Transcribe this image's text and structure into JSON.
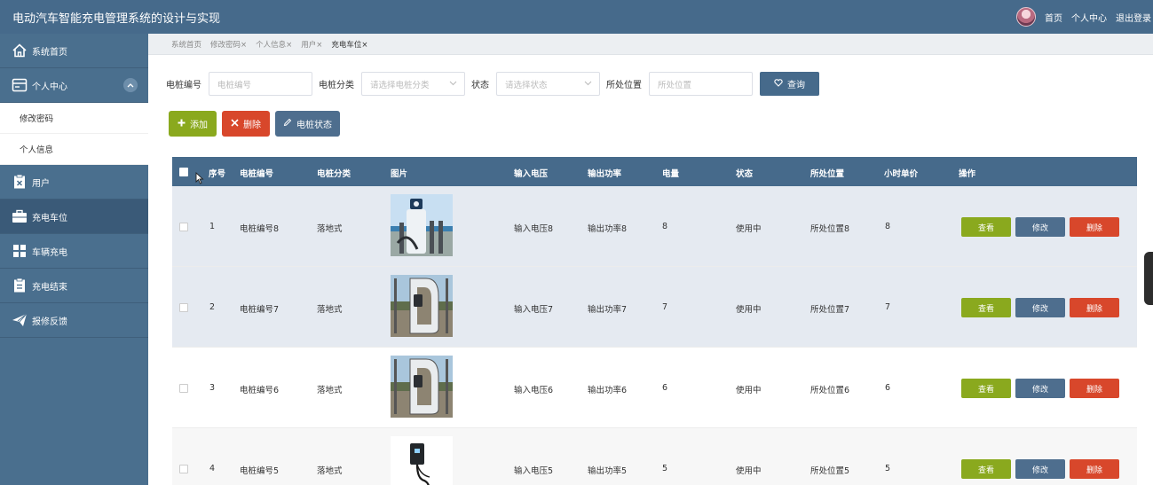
{
  "app": {
    "title": "电动汽车智能充电管理系统的设计与实现"
  },
  "topnav": {
    "home": "首页",
    "profile": "个人中心",
    "logout": "退出登录"
  },
  "sidebar": {
    "items": [
      {
        "label": "系统首页",
        "icon": "home-icon"
      },
      {
        "label": "个人中心",
        "icon": "user-card-icon"
      },
      {
        "label": "修改密码"
      },
      {
        "label": "个人信息"
      },
      {
        "label": "用户",
        "icon": "clipboard-x-icon"
      },
      {
        "label": "充电车位",
        "icon": "briefcase-icon"
      },
      {
        "label": "车辆充电",
        "icon": "grid-icon"
      },
      {
        "label": "充电结束",
        "icon": "clipboard-icon"
      },
      {
        "label": "报修反馈",
        "icon": "paper-plane-icon"
      }
    ]
  },
  "tabs": [
    "系统首页",
    "修改密码×",
    "个人信息×",
    "用户×",
    "充电车位×"
  ],
  "search": {
    "pile_no_label": "电桩编号",
    "pile_no_placeholder": "电桩编号",
    "category_label": "电桩分类",
    "category_placeholder": "请选择电桩分类",
    "status_label": "状态",
    "status_placeholder": "请选择状态",
    "location_label": "所处位置",
    "location_placeholder": "所处位置",
    "button": "查询"
  },
  "actions": {
    "add": "添加",
    "delete": "删除",
    "pile_status": "电桩状态"
  },
  "table": {
    "headers": [
      "序号",
      "电桩编号",
      "电桩分类",
      "图片",
      "输入电压",
      "输出功率",
      "电量",
      "状态",
      "所处位置",
      "小时单价",
      "操作"
    ],
    "rows": [
      {
        "idx": "1",
        "pile_no": "电桩编号8",
        "category": "落地式",
        "voltage": "输入电压8",
        "power": "输出功率8",
        "charge": "8",
        "status": "使用中",
        "location": "所处位置8",
        "price": "8"
      },
      {
        "idx": "2",
        "pile_no": "电桩编号7",
        "category": "落地式",
        "voltage": "输入电压7",
        "power": "输出功率7",
        "charge": "7",
        "status": "使用中",
        "location": "所处位置7",
        "price": "7"
      },
      {
        "idx": "3",
        "pile_no": "电桩编号6",
        "category": "落地式",
        "voltage": "输入电压6",
        "power": "输出功率6",
        "charge": "6",
        "status": "使用中",
        "location": "所处位置6",
        "price": "6"
      },
      {
        "idx": "4",
        "pile_no": "电桩编号5",
        "category": "落地式",
        "voltage": "输入电压5",
        "power": "输出功率5",
        "charge": "5",
        "status": "使用中",
        "location": "所处位置5",
        "price": "5"
      }
    ],
    "row_actions": {
      "view": "查看",
      "edit": "修改",
      "delete": "删除"
    }
  },
  "colors": {
    "header": "#466a8b",
    "sidebar": "#4a6f8e",
    "green": "#8aa91e",
    "red": "#d8472b",
    "steel": "#4e6e8e"
  }
}
